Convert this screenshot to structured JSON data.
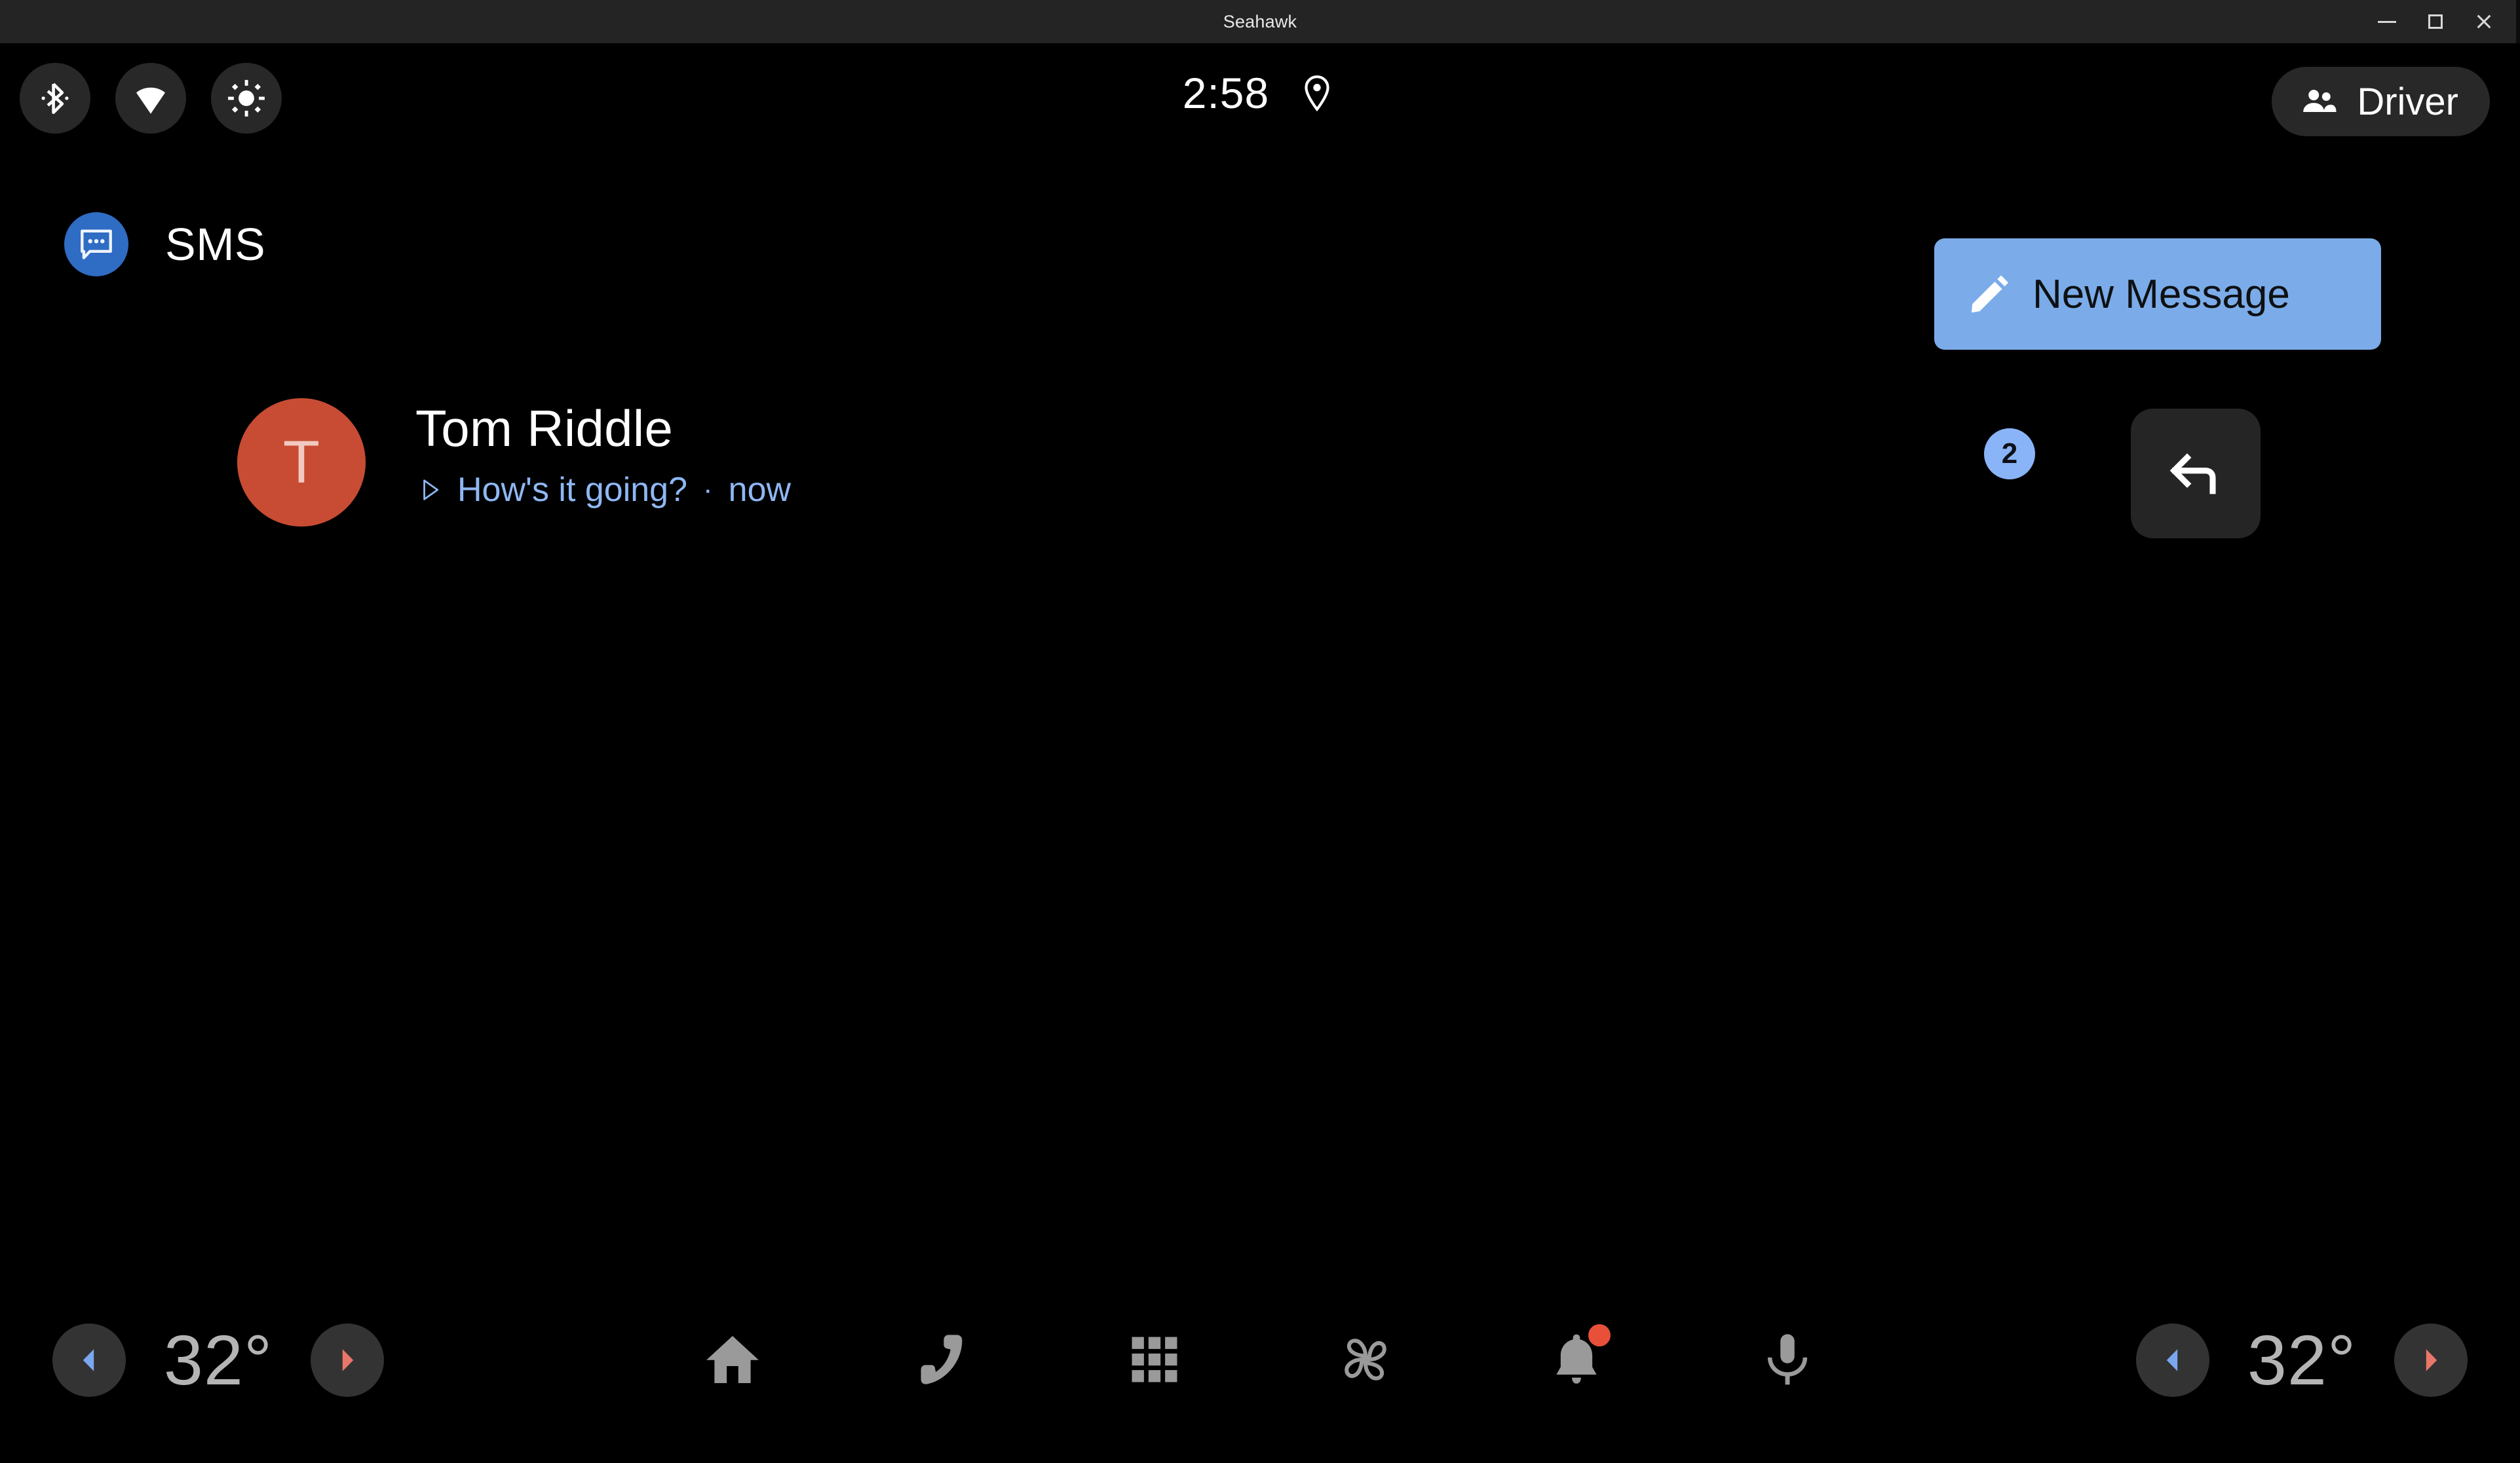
{
  "window": {
    "title": "Seahawk",
    "controls": [
      {
        "name": "minimize",
        "label": "–"
      },
      {
        "name": "maximize",
        "label": "□"
      },
      {
        "name": "close",
        "label": "✕"
      }
    ]
  },
  "status_bar": {
    "left_icons": [
      {
        "name": "bluetooth-icon",
        "label": "bluetooth"
      },
      {
        "name": "wifi-icon",
        "label": "wifi"
      },
      {
        "name": "brightness-icon",
        "label": "brightness"
      }
    ],
    "clock": "2:58",
    "location_icon": "location-pin-icon",
    "profile": {
      "label": "Driver",
      "icon": "people-icon"
    }
  },
  "app_header": {
    "icon": "sms-chat-bubble-icon",
    "title": "SMS",
    "new_message": {
      "label": "New Message",
      "icon": "pencil-edit-icon",
      "color": "#7bace9"
    }
  },
  "conversations": [
    {
      "avatar_letter": "T",
      "avatar_color": "#c74c33",
      "name": "Tom Riddle",
      "play_icon": "play-triangle-icon",
      "preview": "How's it going?",
      "separator": "·",
      "timestamp": "now",
      "unread_count": "2",
      "unread_color": "#8ab4f8",
      "reply_icon": "reply-arrow-icon"
    }
  ],
  "bottom_bar": {
    "temp_left": {
      "decrease_icon": "chevron-left-icon",
      "value": "32°",
      "increase_icon": "chevron-right-icon",
      "decrease_color": "#7ba7f0",
      "increase_color": "#e8776a"
    },
    "temp_right": {
      "decrease_icon": "chevron-left-icon",
      "value": "32°",
      "increase_icon": "chevron-right-icon",
      "decrease_color": "#7ba7f0",
      "increase_color": "#e8776a"
    },
    "nav_items": [
      {
        "name": "home-icon",
        "label": "Home"
      },
      {
        "name": "phone-icon",
        "label": "Phone"
      },
      {
        "name": "apps-grid-icon",
        "label": "Apps"
      },
      {
        "name": "fan-climate-icon",
        "label": "Climate"
      },
      {
        "name": "notifications-bell-icon",
        "label": "Notifications",
        "has_badge": true
      },
      {
        "name": "microphone-icon",
        "label": "Assistant"
      }
    ]
  }
}
